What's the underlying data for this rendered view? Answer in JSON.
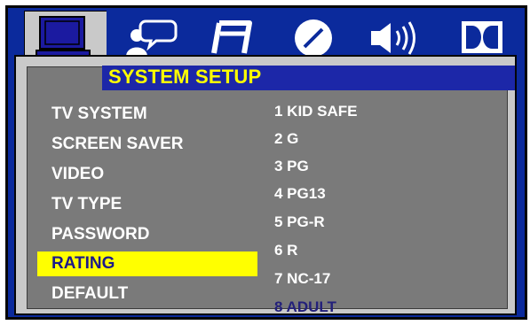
{
  "tabs": [
    {
      "name": "system-setup-tab",
      "icon": "monitor-icon",
      "selected": true
    },
    {
      "name": "language-tab",
      "icon": "person-speech-icon"
    },
    {
      "name": "audio-tab",
      "icon": "music-note-icon"
    },
    {
      "name": "video-tab",
      "icon": "disc-icon"
    },
    {
      "name": "speaker-tab",
      "icon": "speaker-icon"
    },
    {
      "name": "dolby-tab",
      "icon": "dolby-icon"
    }
  ],
  "panel": {
    "title": "SYSTEM SETUP"
  },
  "menu": {
    "items": [
      {
        "label": "TV SYSTEM"
      },
      {
        "label": "SCREEN SAVER"
      },
      {
        "label": "VIDEO"
      },
      {
        "label": "TV TYPE"
      },
      {
        "label": "PASSWORD"
      },
      {
        "label": "RATING",
        "selected": true
      },
      {
        "label": "DEFAULT"
      }
    ]
  },
  "rating_options": {
    "items": [
      {
        "label": "1 KID SAFE"
      },
      {
        "label": "2 G"
      },
      {
        "label": "3 PG"
      },
      {
        "label": "4 PG13"
      },
      {
        "label": "5 PG-R"
      },
      {
        "label": "6 R"
      },
      {
        "label": "7 NC-17"
      },
      {
        "label": "8 ADULT",
        "current": true
      }
    ]
  },
  "colors": {
    "frame_blue": "#0b2a9c",
    "highlight_yellow": "#ffff00",
    "panel_gray": "#7a7a7a",
    "current_value_blue": "#23207a"
  }
}
